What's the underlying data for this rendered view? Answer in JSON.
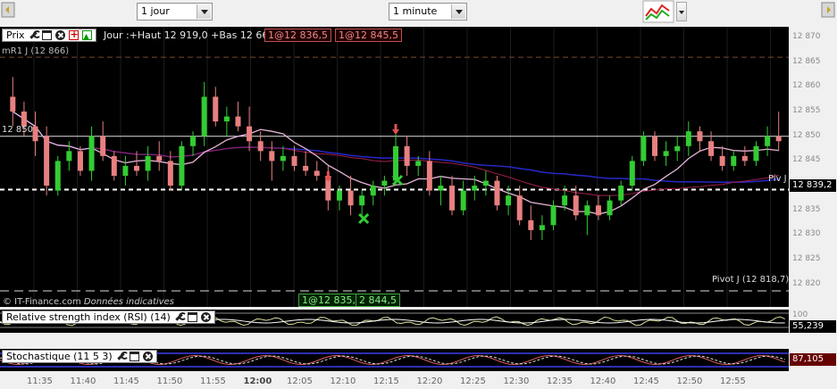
{
  "toolbar": {
    "period_select": "1 jour",
    "interval_select": "1 minute"
  },
  "price_pane": {
    "title": "Prix",
    "info": "Jour :+Haut 12 919,0 +Bas 12 664,6",
    "bid_box": "1@12 836,5",
    "ask_box": "1@12 845,5",
    "resistance_label": "mR1 J (12 866)",
    "level_label": "12 850",
    "piv_label": "Piv J",
    "pivot_label": "Pivot J (12 818,7)",
    "copyright": "© IT-Finance.com",
    "indicative": "Données indicatives",
    "bottom_bid": "1@12 835,5",
    "bottom_ask": "2 844,5",
    "current_price": "12 839,2",
    "colors": {
      "up": "#33cc33",
      "down": "#e88080",
      "ma_blue": "#2828c8",
      "ma_pink": "#e8b4d8",
      "ma_red": "#a0204c"
    }
  },
  "price_axis": [
    "12 870",
    "12 865",
    "12 860",
    "12 855",
    "12 850",
    "12 845",
    "12 840",
    "12 835",
    "12 830",
    "12 825",
    "12 820"
  ],
  "rsi_pane": {
    "title": "Relative strength index (RSI) (14)",
    "level": "100",
    "value": "55,239"
  },
  "stoch_pane": {
    "title": "Stochastique (11 5 3)",
    "value": "87,105"
  },
  "time_axis": [
    "11:35",
    "11:40",
    "11:45",
    "11:50",
    "11:55",
    "12:00",
    "12:05",
    "12:10",
    "12:15",
    "12:20",
    "12:25",
    "12:30",
    "12:35",
    "12:40",
    "12:45",
    "12:50",
    "12:55"
  ],
  "chart_data": {
    "type": "candlestick",
    "ylim": [
      12818,
      12872
    ],
    "candles": [
      [
        12858,
        12862,
        12852,
        12855
      ],
      [
        12855,
        12857,
        12850,
        12852
      ],
      [
        12852,
        12855,
        12846,
        12849
      ],
      [
        12850,
        12852,
        12838,
        12840
      ],
      [
        12839,
        12846,
        12838,
        12845
      ],
      [
        12845,
        12849,
        12843,
        12847
      ],
      [
        12847,
        12848,
        12842,
        12843
      ],
      [
        12843,
        12852,
        12841,
        12850
      ],
      [
        12850,
        12853,
        12845,
        12846
      ],
      [
        12846,
        12847,
        12841,
        12842
      ],
      [
        12842,
        12846,
        12840,
        12844
      ],
      [
        12844,
        12847,
        12842,
        12843
      ],
      [
        12843,
        12848,
        12841,
        12846
      ],
      [
        12846,
        12849,
        12843,
        12845
      ],
      [
        12845,
        12847,
        12839,
        12840
      ],
      [
        12840,
        12849,
        12839,
        12848
      ],
      [
        12848,
        12851,
        12846,
        12850
      ],
      [
        12850,
        12861,
        12848,
        12858
      ],
      [
        12858,
        12860,
        12852,
        12853
      ],
      [
        12853,
        12856,
        12850,
        12854
      ],
      [
        12854,
        12857,
        12851,
        12852
      ],
      [
        12852,
        12856,
        12847,
        12849
      ],
      [
        12849,
        12851,
        12845,
        12847
      ],
      [
        12847,
        12849,
        12841,
        12845
      ],
      [
        12845,
        12848,
        12843,
        12846
      ],
      [
        12846,
        12848,
        12843,
        12844
      ],
      [
        12844,
        12847,
        12842,
        12843
      ],
      [
        12843,
        12845,
        12841,
        12842
      ],
      [
        12842,
        12844,
        12835,
        12837
      ],
      [
        12837,
        12840,
        12835,
        12839
      ],
      [
        12839,
        12842,
        12834,
        12836
      ],
      [
        12836,
        12839,
        12834,
        12838
      ],
      [
        12838,
        12841,
        12836,
        12840
      ],
      [
        12840,
        12842,
        12838,
        12841
      ],
      [
        12841,
        12851,
        12840,
        12848
      ],
      [
        12848,
        12850,
        12842,
        12844
      ],
      [
        12844,
        12846,
        12842,
        12845
      ],
      [
        12845,
        12847,
        12838,
        12839
      ],
      [
        12839,
        12842,
        12836,
        12840
      ],
      [
        12840,
        12842,
        12834,
        12835
      ],
      [
        12835,
        12841,
        12834,
        12839
      ],
      [
        12839,
        12842,
        12837,
        12840
      ],
      [
        12840,
        12843,
        12838,
        12841
      ],
      [
        12841,
        12842,
        12835,
        12836
      ],
      [
        12836,
        12840,
        12834,
        12838
      ],
      [
        12838,
        12840,
        12832,
        12833
      ],
      [
        12833,
        12836,
        12829,
        12831
      ],
      [
        12831,
        12834,
        12829,
        12832
      ],
      [
        12832,
        12837,
        12831,
        12836
      ],
      [
        12836,
        12840,
        12835,
        12838
      ],
      [
        12838,
        12840,
        12833,
        12834
      ],
      [
        12834,
        12837,
        12830,
        12836
      ],
      [
        12836,
        12838,
        12833,
        12834
      ],
      [
        12834,
        12838,
        12833,
        12837
      ],
      [
        12837,
        12841,
        12836,
        12840
      ],
      [
        12840,
        12846,
        12839,
        12845
      ],
      [
        12845,
        12851,
        12844,
        12850
      ],
      [
        12850,
        12851,
        12845,
        12846
      ],
      [
        12846,
        12849,
        12844,
        12847
      ],
      [
        12847,
        12850,
        12845,
        12848
      ],
      [
        12848,
        12853,
        12846,
        12851
      ],
      [
        12851,
        12852,
        12847,
        12849
      ],
      [
        12849,
        12851,
        12845,
        12846
      ],
      [
        12846,
        12848,
        12843,
        12844
      ],
      [
        12844,
        12847,
        12843,
        12846
      ],
      [
        12846,
        12848,
        12844,
        12845
      ],
      [
        12845,
        12849,
        12844,
        12848
      ],
      [
        12848,
        12852,
        12846,
        12850
      ],
      [
        12850,
        12855,
        12847,
        12849
      ]
    ]
  }
}
